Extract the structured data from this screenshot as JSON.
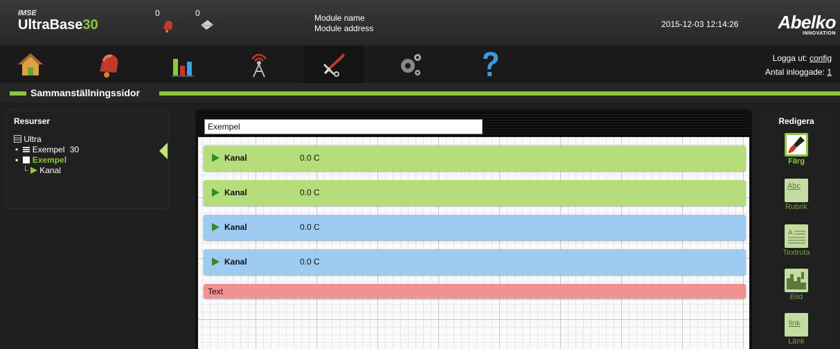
{
  "header": {
    "brand_small": "IMSE",
    "brand_name": "UltraBase",
    "brand_number": "30",
    "alarm_count": "0",
    "message_count": "0",
    "module_name": "Module name",
    "module_address": "Module address",
    "datetime": "2015-12-03 12:14:26",
    "logo_text": "Abelko",
    "logo_sub": "INNOVATION"
  },
  "nav": {
    "items": [
      {
        "icon": "home-icon"
      },
      {
        "icon": "alarm-bell-icon"
      },
      {
        "icon": "bar-chart-icon"
      },
      {
        "icon": "antenna-icon"
      },
      {
        "icon": "tools-icon"
      },
      {
        "icon": "gears-icon"
      },
      {
        "icon": "help-icon"
      }
    ],
    "logout_prefix": "Logga ut:",
    "logout_user": "config",
    "logged_in_prefix": "Antal inloggade:",
    "logged_in_count": "1"
  },
  "section": {
    "title": "Sammanställningssidor"
  },
  "resources": {
    "title": "Resurser",
    "tree": {
      "root": "Ultra",
      "item1": "Exempel",
      "item1_count": "30",
      "item2": "Exempel",
      "item3": "Kanal"
    }
  },
  "canvas": {
    "page_title": "Exempel",
    "widgets": [
      {
        "type": "channel",
        "label": "Kanal",
        "value": "0.0 C",
        "color": "#b6dd7c"
      },
      {
        "type": "channel",
        "label": "Kanal",
        "value": "0.0 C",
        "color": "#b6dd7c"
      },
      {
        "type": "channel",
        "label": "Kanal",
        "value": "0.0 C",
        "color": "#9dcbf2"
      },
      {
        "type": "channel",
        "label": "Kanal",
        "value": "0.0 C",
        "color": "#9dcbf2"
      },
      {
        "type": "text",
        "label": "Text",
        "color": "#f29191"
      }
    ]
  },
  "edit": {
    "title": "Redigera",
    "tools": [
      {
        "label": "Färg",
        "icon": "paint-brush-icon"
      },
      {
        "label": "Rubrik",
        "icon": "heading-icon"
      },
      {
        "label": "Textruta",
        "icon": "textbox-icon"
      },
      {
        "label": "Bild",
        "icon": "image-icon"
      },
      {
        "label": "Länk",
        "icon": "link-icon",
        "icon_text": "link"
      }
    ]
  },
  "colors": {
    "accent": "#8dc63f",
    "channel_green": "#b6dd7c",
    "channel_blue": "#9dcbf2",
    "text_red": "#f29191"
  }
}
